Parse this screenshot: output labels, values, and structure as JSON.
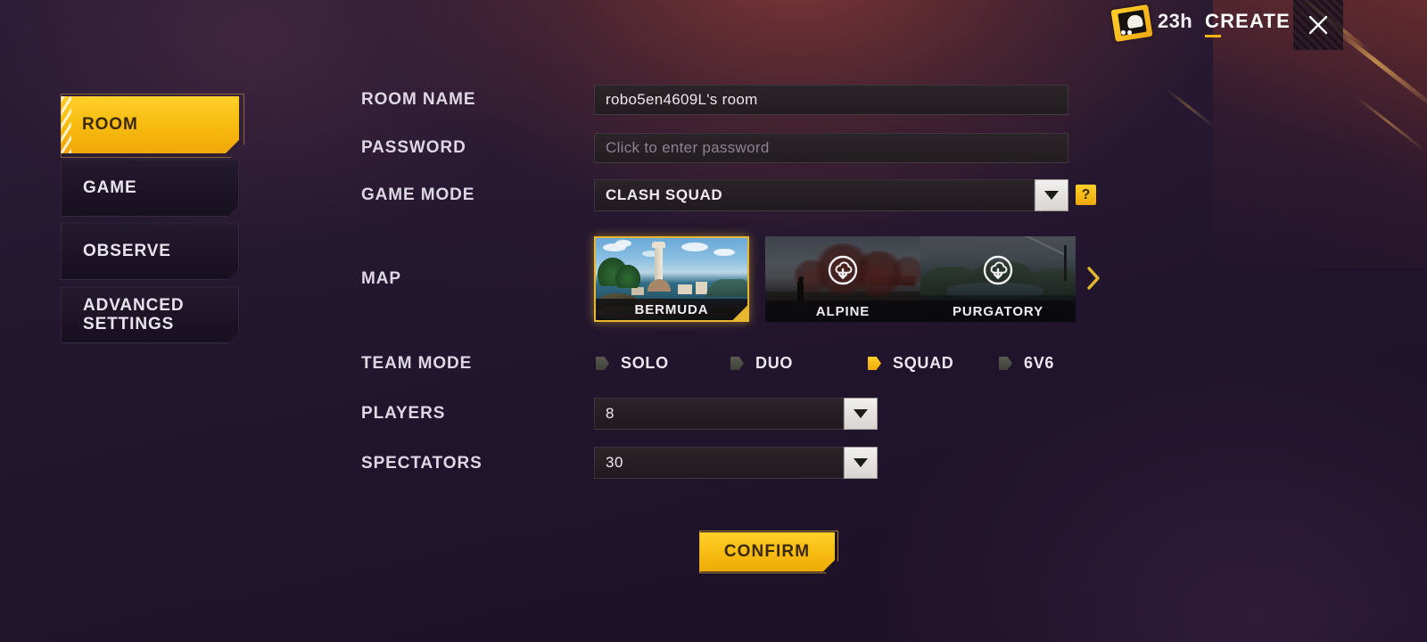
{
  "topbar": {
    "token_icon": "card-token-icon",
    "time_remaining": "23h",
    "create_label": "CREATE",
    "close_icon": "close-x-icon"
  },
  "sidebar": {
    "items": [
      {
        "label": "ROOM",
        "active": true
      },
      {
        "label": "GAME",
        "active": false
      },
      {
        "label": "OBSERVE",
        "active": false
      },
      {
        "label": "ADVANCED SETTINGS",
        "active": false
      }
    ]
  },
  "form": {
    "room_name": {
      "label": "ROOM NAME",
      "value": "robo5en4609L's room"
    },
    "password": {
      "label": "PASSWORD",
      "value": "",
      "placeholder": "Click to enter password"
    },
    "game_mode": {
      "label": "GAME MODE",
      "value": "CLASH SQUAD",
      "help_badge": "?"
    },
    "map": {
      "label": "MAP",
      "next_icon": "chevron-right-icon",
      "cards": [
        {
          "name": "BERMUDA",
          "selected": true,
          "locked": false
        },
        {
          "name": "ALPINE",
          "selected": false,
          "locked": true,
          "icon": "download-cloud-icon"
        },
        {
          "name": "PURGATORY",
          "selected": false,
          "locked": true,
          "icon": "download-cloud-icon"
        }
      ]
    },
    "team_mode": {
      "label": "TEAM MODE",
      "options": [
        {
          "label": "SOLO",
          "selected": false
        },
        {
          "label": "DUO",
          "selected": false
        },
        {
          "label": "SQUAD",
          "selected": true
        },
        {
          "label": "6V6",
          "selected": false
        }
      ]
    },
    "players": {
      "label": "PLAYERS",
      "value": "8"
    },
    "spectators": {
      "label": "SPECTATORS",
      "value": "30"
    }
  },
  "confirm": {
    "label": "CONFIRM"
  },
  "colors": {
    "accent_gold": "#f7bb11",
    "background": "#20142c",
    "field_dark": "#2b2429",
    "text_light": "#ece7ef"
  }
}
